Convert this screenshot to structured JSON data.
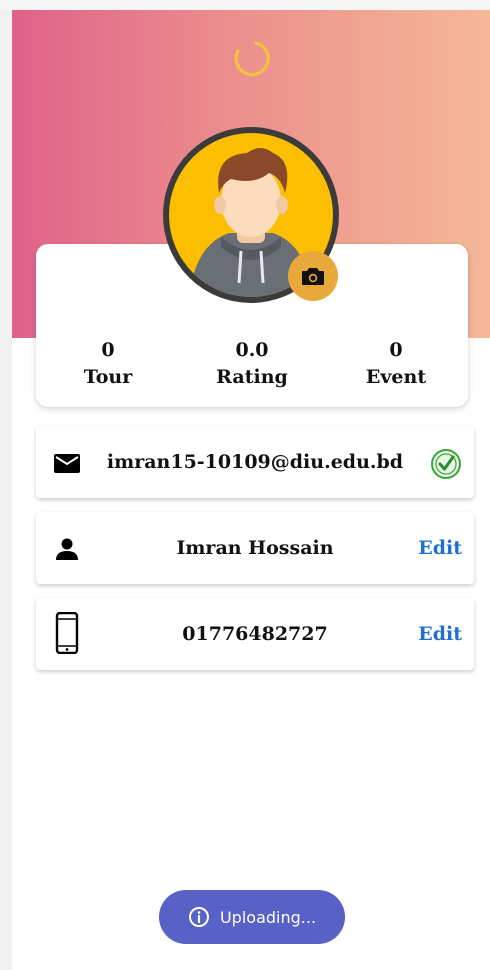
{
  "stats": {
    "tour": {
      "value": "0",
      "label": "Tour"
    },
    "rating": {
      "value": "0.0",
      "label": "Rating"
    },
    "event": {
      "value": "0",
      "label": "Event"
    }
  },
  "profile": {
    "email": "imran15-10109@diu.edu.bd",
    "name": "Imran Hossain",
    "phone": "01776482727",
    "edit_label": "Edit"
  },
  "toast": {
    "text": "Uploading..."
  },
  "colors": {
    "header_gradient_start": "#e0628a",
    "header_gradient_end": "#f5b896",
    "spinner": "#f5c33b",
    "avatar_bg": "#fbbe00",
    "camera_button": "#e9a93a",
    "edit_link": "#1f6ed4",
    "verified": "#3aa53a",
    "toast_bg": "#5761c6"
  },
  "icons": {
    "spinner": "loading-spinner-icon",
    "camera": "camera-icon",
    "email": "mail-icon",
    "verified": "check-circle-icon",
    "person": "person-icon",
    "phone": "smartphone-icon",
    "info": "info-icon"
  }
}
